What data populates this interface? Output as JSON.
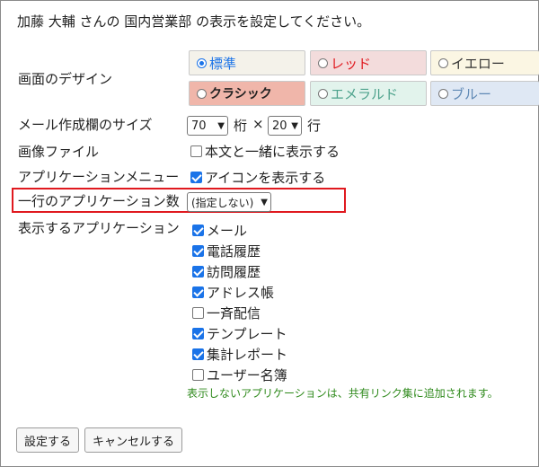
{
  "header_text": "加藤 大輔 さんの 国内営業部 の表示を設定してください。",
  "labels": {
    "design": "画面のデザイン",
    "memo_size": "メール作成欄のサイズ",
    "image_file": "画像ファイル",
    "app_menu": "アプリケーションメニュー",
    "apps_per_row": "一行のアプリケーション数",
    "display_apps": "表示するアプリケーション"
  },
  "design_options": [
    {
      "label": "標準",
      "selected": true,
      "color": "#f4f2ea"
    },
    {
      "label": "レッド",
      "selected": false,
      "color": "#f3dcdc"
    },
    {
      "label": "イエロー",
      "selected": false,
      "color": "#fbf6e3"
    },
    {
      "label": "クラシック",
      "selected": false,
      "color": "#f0b6aa"
    },
    {
      "label": "エメラルド",
      "selected": false,
      "color": "#e2f3ec"
    },
    {
      "label": "ブルー",
      "selected": false,
      "color": "#dfe8f4"
    }
  ],
  "memo": {
    "cols_value": "70",
    "cols_unit": "桁",
    "times": "×",
    "rows_value": "20",
    "rows_unit": "行"
  },
  "image_option": {
    "label": "本文と一緒に表示する",
    "checked": false
  },
  "app_menu_option": {
    "label": "アイコンを表示する",
    "checked": true
  },
  "apps_per_row_value": "(指定しない)",
  "apps": [
    {
      "label": "メール",
      "checked": true
    },
    {
      "label": "電話履歴",
      "checked": true
    },
    {
      "label": "訪問履歴",
      "checked": true
    },
    {
      "label": "アドレス帳",
      "checked": true
    },
    {
      "label": "一斉配信",
      "checked": false
    },
    {
      "label": "テンプレート",
      "checked": true
    },
    {
      "label": "集計レポート",
      "checked": true
    },
    {
      "label": "ユーザー名簿",
      "checked": false
    }
  ],
  "note": "表示しないアプリケーションは、共有リンク集に追加されます。",
  "buttons": {
    "save": "設定する",
    "cancel": "キャンセルする"
  },
  "colors": {
    "highlight": "#e0191f",
    "note": "#2f8a1c",
    "accent": "#1a73e8"
  }
}
